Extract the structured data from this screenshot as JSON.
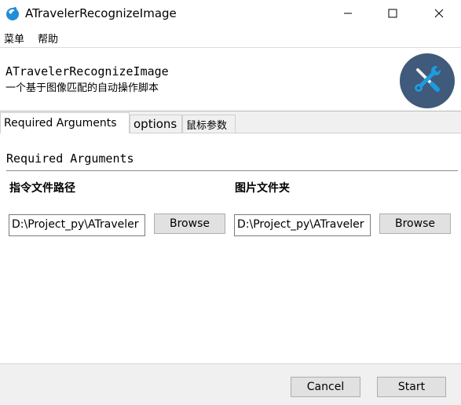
{
  "window": {
    "title": "ATravelerRecognizeImage",
    "icon": "droplet-app-icon",
    "controls": [
      "minimize-icon",
      "maximize-icon",
      "close-icon"
    ]
  },
  "menu": {
    "items": [
      {
        "label": "菜单"
      },
      {
        "label": "帮助"
      }
    ]
  },
  "header": {
    "title": "ATravelerRecognizeImage",
    "subtitle": "一个基于图像匹配的自动操作脚本",
    "logo_icon": "tools-wrench-screwdriver-icon",
    "logo_color": "#3f5a7a"
  },
  "tabs": [
    {
      "label": "Required Arguments",
      "active": true
    },
    {
      "label": "options",
      "active": false
    },
    {
      "label": "鼠标参数",
      "active": false
    }
  ],
  "section": {
    "title": "Required Arguments"
  },
  "fields": [
    {
      "label": "指令文件路径",
      "value": "D:\\Project_py\\ATraveler",
      "browse_label": "Browse"
    },
    {
      "label": "图片文件夹",
      "value": "D:\\Project_py\\ATraveler",
      "browse_label": "Browse"
    }
  ],
  "footer": {
    "cancel_label": "Cancel",
    "start_label": "Start"
  }
}
